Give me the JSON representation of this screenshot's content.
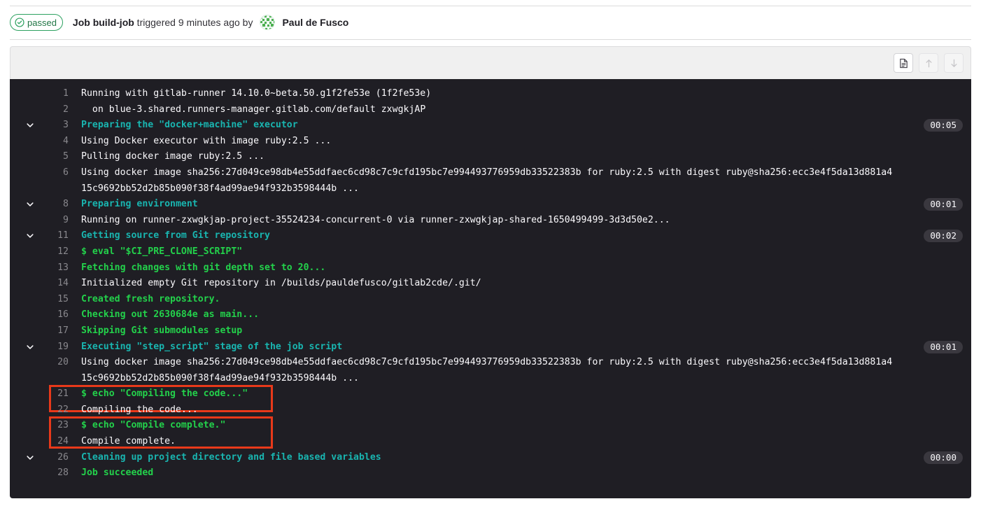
{
  "header": {
    "status_label": "passed",
    "status_icon": "check-circle-icon",
    "status_color": "#217645",
    "title_strong": "Job build-job",
    "title_rest": " triggered 9 minutes ago by",
    "user_name": "Paul de Fusco",
    "avatar_icon": "identicon-avatar"
  },
  "toolbar": {
    "buttons": [
      {
        "name": "show-raw-button",
        "icon": "document-icon",
        "enabled": true
      },
      {
        "name": "scroll-to-top-button",
        "icon": "arrow-up-icon",
        "enabled": false
      },
      {
        "name": "scroll-to-bottom-button",
        "icon": "arrow-down-icon",
        "enabled": false
      }
    ]
  },
  "log": {
    "background": "#1f1e24",
    "colors": {
      "default_text": "#fbfafd",
      "section_header": "#19b5b0",
      "success_text": "#23d14b",
      "line_number": "#89888d",
      "duration_badge_bg": "#3a383f",
      "annotation": "#e8391a"
    },
    "lines": [
      {
        "num": "1",
        "text": "Running with gitlab-runner 14.10.0~beta.50.g1f2fe53e (1f2fe53e)",
        "style": "plain",
        "collapsible": false,
        "duration": ""
      },
      {
        "num": "2",
        "text": "  on blue-3.shared.runners-manager.gitlab.com/default zxwgkjAP",
        "style": "plain",
        "collapsible": false,
        "duration": ""
      },
      {
        "num": "3",
        "text": "Preparing the \"docker+machine\" executor",
        "style": "cyan",
        "collapsible": true,
        "duration": "00:05"
      },
      {
        "num": "4",
        "text": "Using Docker executor with image ruby:2.5 ...",
        "style": "plain",
        "collapsible": false,
        "duration": ""
      },
      {
        "num": "5",
        "text": "Pulling docker image ruby:2.5 ...",
        "style": "plain",
        "collapsible": false,
        "duration": ""
      },
      {
        "num": "6",
        "text": "Using docker image sha256:27d049ce98db4e55ddfaec6cd98c7c9cfd195bc7e994493776959db33522383b for ruby:2.5 with digest ruby@sha256:ecc3e4f5da13d881a415c9692bb52d2b85b090f38f4ad99ae94f932b3598444b ...",
        "style": "plain",
        "collapsible": false,
        "duration": ""
      },
      {
        "num": "8",
        "text": "Preparing environment",
        "style": "cyan",
        "collapsible": true,
        "duration": "00:01"
      },
      {
        "num": "9",
        "text": "Running on runner-zxwgkjap-project-35524234-concurrent-0 via runner-zxwgkjap-shared-1650499499-3d3d50e2...",
        "style": "plain",
        "collapsible": false,
        "duration": ""
      },
      {
        "num": "11",
        "text": "Getting source from Git repository",
        "style": "cyan",
        "collapsible": true,
        "duration": "00:02"
      },
      {
        "num": "12",
        "text": "$ eval \"$CI_PRE_CLONE_SCRIPT\"",
        "style": "green",
        "collapsible": false,
        "duration": ""
      },
      {
        "num": "13",
        "text": "Fetching changes with git depth set to 20...",
        "style": "green",
        "collapsible": false,
        "duration": ""
      },
      {
        "num": "14",
        "text": "Initialized empty Git repository in /builds/pauldefusco/gitlab2cde/.git/",
        "style": "plain",
        "collapsible": false,
        "duration": ""
      },
      {
        "num": "15",
        "text": "Created fresh repository.",
        "style": "green",
        "collapsible": false,
        "duration": ""
      },
      {
        "num": "16",
        "text": "Checking out 2630684e as main...",
        "style": "green",
        "collapsible": false,
        "duration": ""
      },
      {
        "num": "17",
        "text": "Skipping Git submodules setup",
        "style": "green",
        "collapsible": false,
        "duration": ""
      },
      {
        "num": "19",
        "text": "Executing \"step_script\" stage of the job script",
        "style": "cyan",
        "collapsible": true,
        "duration": "00:01"
      },
      {
        "num": "20",
        "text": "Using docker image sha256:27d049ce98db4e55ddfaec6cd98c7c9cfd195bc7e994493776959db33522383b for ruby:2.5 with digest ruby@sha256:ecc3e4f5da13d881a415c9692bb52d2b85b090f38f4ad99ae94f932b3598444b ...",
        "style": "plain",
        "collapsible": false,
        "duration": ""
      },
      {
        "num": "21",
        "text": "$ echo \"Compiling the code...\"",
        "style": "green",
        "collapsible": false,
        "duration": ""
      },
      {
        "num": "22",
        "text": "Compiling the code...",
        "style": "plain",
        "collapsible": false,
        "duration": ""
      },
      {
        "num": "23",
        "text": "$ echo \"Compile complete.\"",
        "style": "green",
        "collapsible": false,
        "duration": ""
      },
      {
        "num": "24",
        "text": "Compile complete.",
        "style": "plain",
        "collapsible": false,
        "duration": ""
      },
      {
        "num": "26",
        "text": "Cleaning up project directory and file based variables",
        "style": "cyan",
        "collapsible": true,
        "duration": "00:00"
      },
      {
        "num": "28",
        "text": "Job succeeded",
        "style": "green",
        "collapsible": false,
        "duration": ""
      }
    ],
    "annotations": [
      {
        "name": "highlight-box-compiling",
        "covers": [
          "21",
          "22"
        ]
      },
      {
        "name": "highlight-box-compile-complete",
        "covers": [
          "23",
          "24"
        ]
      }
    ]
  }
}
